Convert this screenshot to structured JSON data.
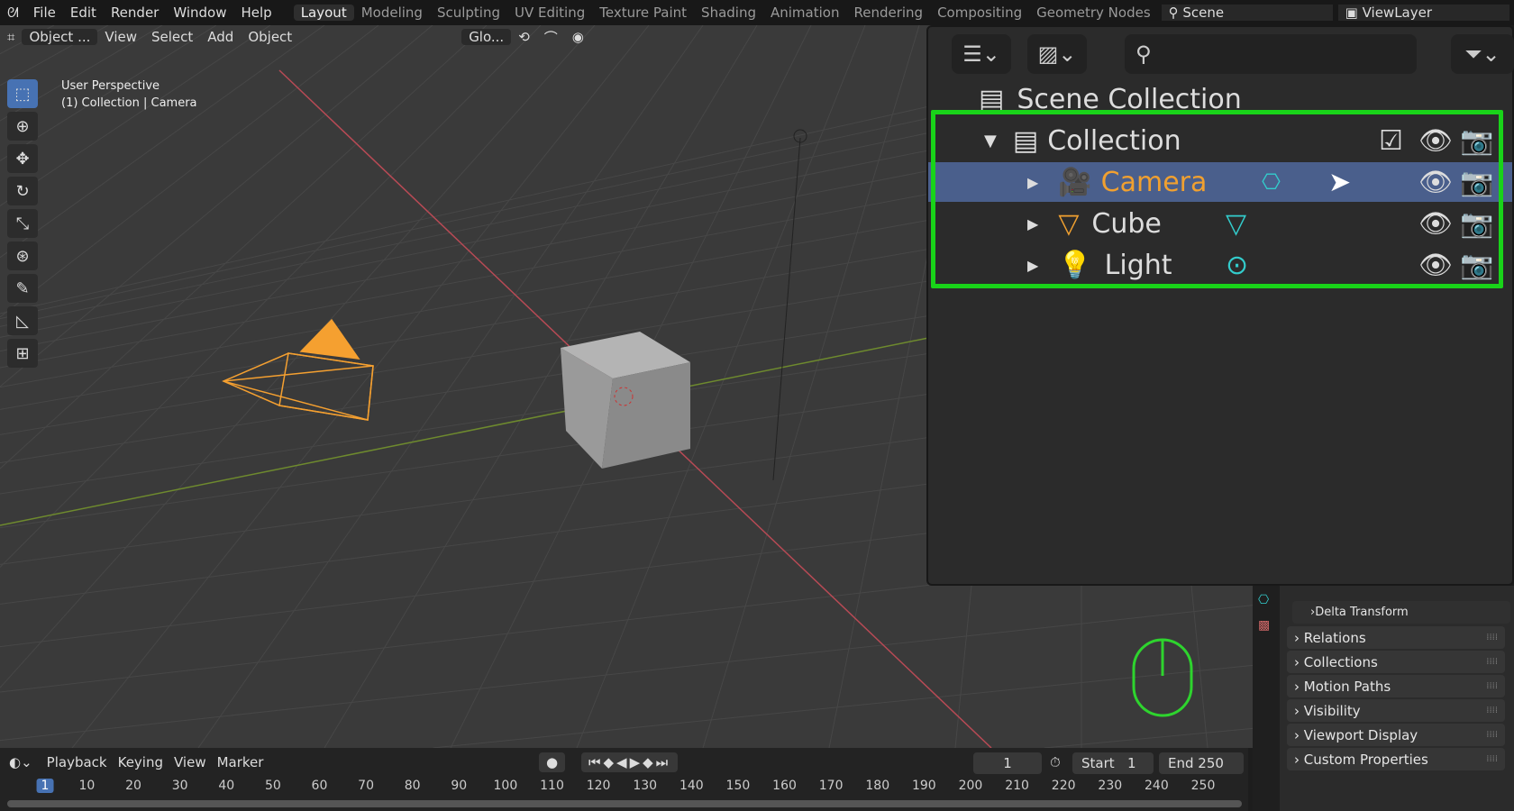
{
  "topbar": {
    "menus": [
      "File",
      "Edit",
      "Render",
      "Window",
      "Help"
    ],
    "workspaces": [
      "Layout",
      "Modeling",
      "Sculpting",
      "UV Editing",
      "Texture Paint",
      "Shading",
      "Animation",
      "Rendering",
      "Compositing",
      "Geometry Nodes"
    ],
    "active_workspace": "Layout",
    "scene": "Scene",
    "view_layer": "ViewLayer"
  },
  "viewport_header": {
    "mode": "Object ...",
    "menus": [
      "View",
      "Select",
      "Add",
      "Object"
    ],
    "orientation": "Glo..."
  },
  "viewport": {
    "perspective": "User Perspective",
    "context": "(1) Collection | Camera"
  },
  "outliner": {
    "root": "Scene Collection",
    "collection": "Collection",
    "items": [
      {
        "name": "Camera",
        "selected": true,
        "color": "#f0a030"
      },
      {
        "name": "Cube",
        "selected": false
      },
      {
        "name": "Light",
        "selected": false
      }
    ],
    "highlight_color": "#19d319"
  },
  "properties": {
    "sections": [
      "Delta Transform",
      "Relations",
      "Collections",
      "Motion Paths",
      "Visibility",
      "Viewport Display",
      "Custom Properties"
    ]
  },
  "timeline": {
    "menus": [
      "Playback",
      "Keying",
      "View",
      "Marker"
    ],
    "current_frame": "1",
    "start_label": "Start",
    "start": "1",
    "end_label": "End",
    "end": "250",
    "ticks": [
      "1",
      "10",
      "20",
      "30",
      "40",
      "50",
      "60",
      "70",
      "80",
      "90",
      "100",
      "110",
      "120",
      "130",
      "140",
      "150",
      "160",
      "170",
      "180",
      "190",
      "200",
      "210",
      "220",
      "230",
      "240",
      "250"
    ]
  }
}
